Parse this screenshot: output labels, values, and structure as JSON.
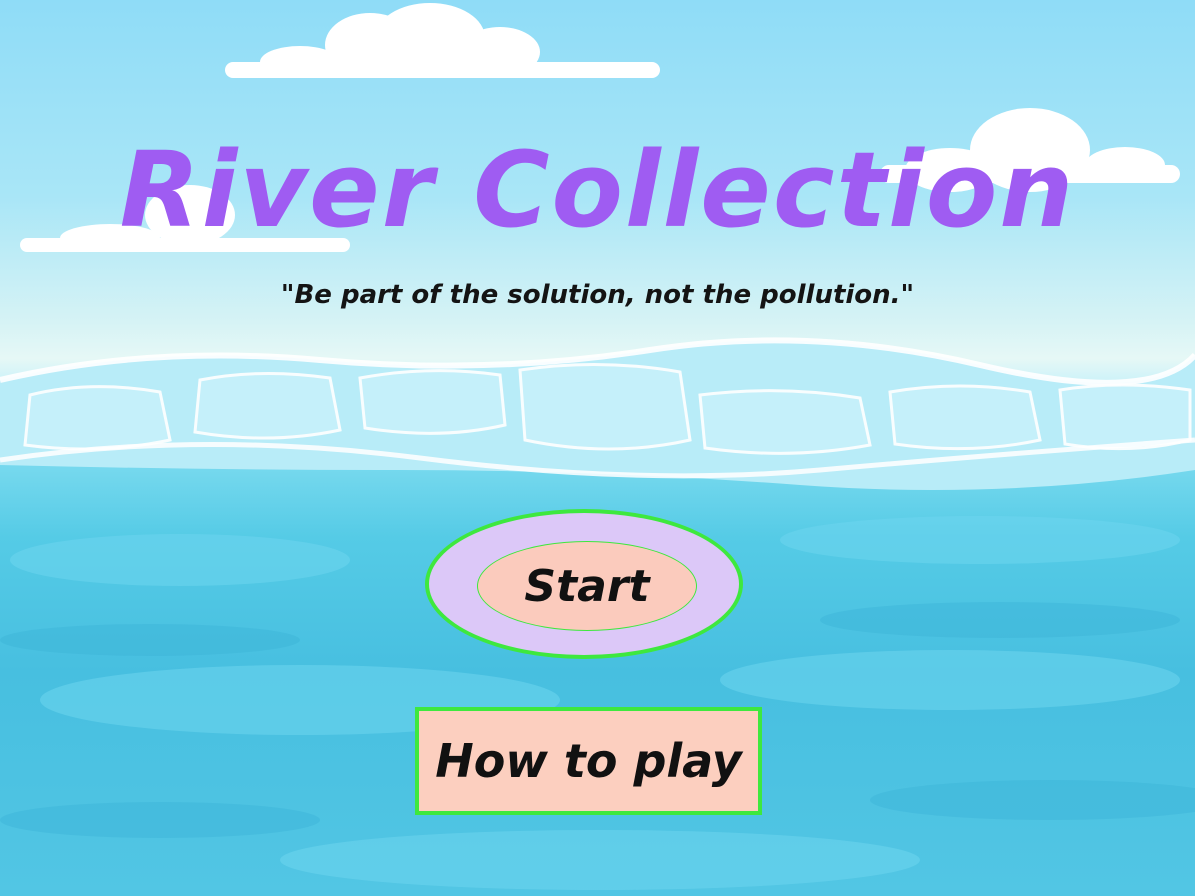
{
  "game": {
    "title": "River Collection",
    "tagline": "\"Be part of the solution, not the pollution.\"",
    "start_label": "Start",
    "how_to_play_label": "How to play"
  },
  "colors": {
    "title": "#9f5cf2",
    "button_border": "#3ee83e",
    "start_outer_fill": "#dcc8f8",
    "button_fill": "#fccfbf",
    "sky": "#8fdcf7",
    "water": "#47bfe0"
  }
}
